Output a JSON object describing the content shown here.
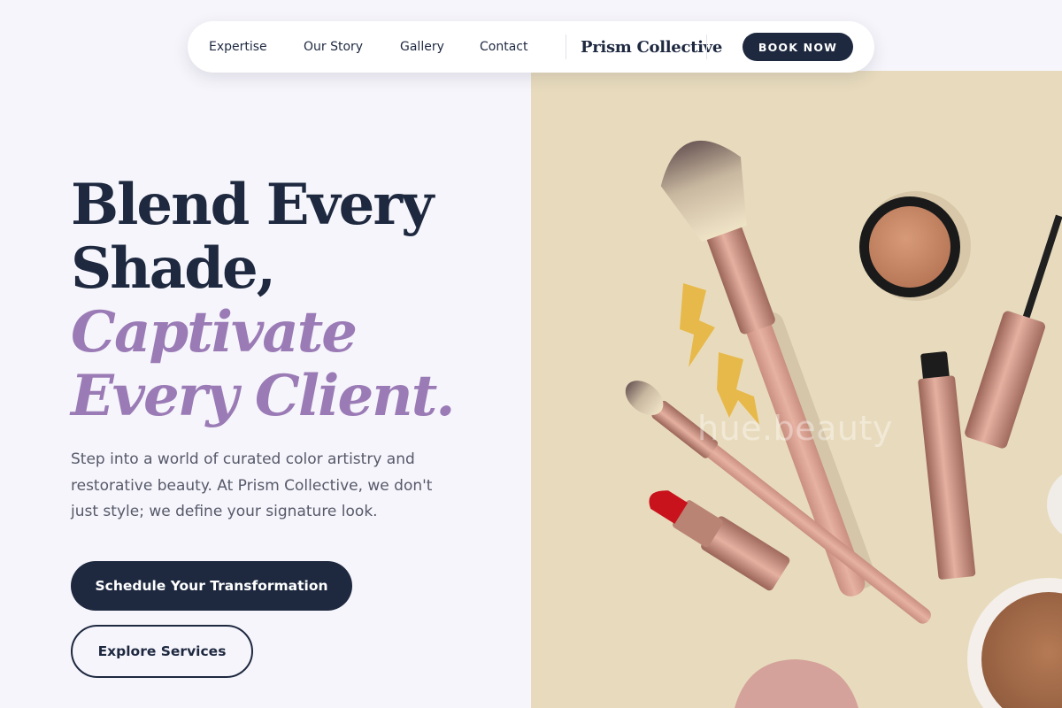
{
  "nav": {
    "links": [
      "Expertise",
      "Our Story",
      "Gallery",
      "Contact"
    ],
    "brand": "Prism Collective",
    "cta": "BOOK NOW"
  },
  "hero": {
    "headline_line1": "Blend Every",
    "headline_line2": "Shade,",
    "headline_accent_line1": "Captivate",
    "headline_accent_line2": "Every Client.",
    "subtext": "Step into a world of curated color artistry and restorative beauty. At Prism Collective, we don't just style; we define your signature look.",
    "primary_cta": "Schedule Your Transformation",
    "secondary_cta": "Explore Services"
  },
  "image": {
    "watermark": "hue.beauty"
  },
  "colors": {
    "navy": "#1e2940",
    "accent_purple": "#9b7bb6",
    "page_background": "#f6f5fb",
    "image_background": "#e8dbbd"
  }
}
